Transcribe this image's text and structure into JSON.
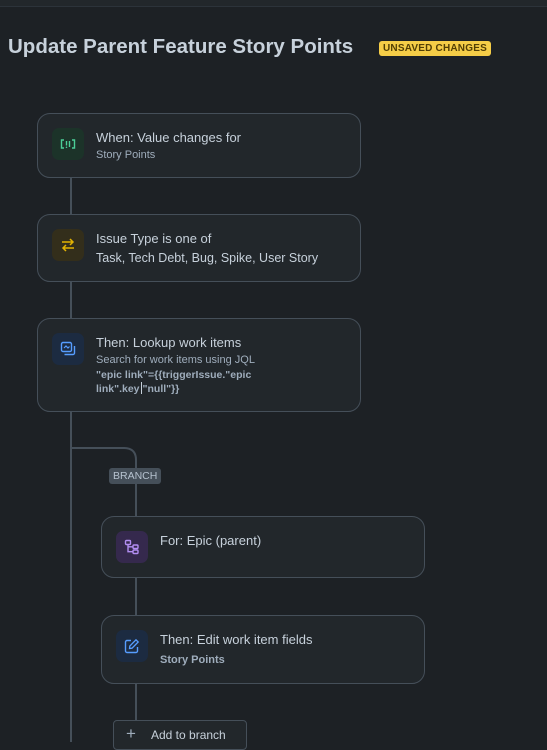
{
  "header": {
    "title": "Update Parent Feature Story Points",
    "status_badge": "UNSAVED CHANGES"
  },
  "flow": {
    "trigger": {
      "title": "When: Value changes for",
      "subtitle": "Story Points",
      "icon": "code-brackets-icon",
      "color": "#4bce97"
    },
    "condition": {
      "title": "Issue Type is one of",
      "subtitle": "Task, Tech Debt, Bug, Spike, User Story",
      "icon": "swap-arrows-icon",
      "color": "#e2b203"
    },
    "lookup": {
      "title": "Then: Lookup work items",
      "subtitle": "Search for work items using JQL",
      "jql_line1": "\"epic link\"={{triggerIssue.\"epic",
      "jql_line2a": "link\".key",
      "jql_line2b": "\"null\"}}",
      "icon": "copy-lookup-icon",
      "color": "#579dff"
    },
    "branch": {
      "label": "BRANCH",
      "for_block": {
        "title": "For: Epic (parent)",
        "icon": "hierarchy-icon",
        "color": "#b38ef3"
      },
      "edit_block": {
        "title": "Then: Edit work item fields",
        "subtitle": "Story Points",
        "icon": "edit-icon",
        "color": "#579dff"
      },
      "add_label": "Add to branch"
    }
  }
}
